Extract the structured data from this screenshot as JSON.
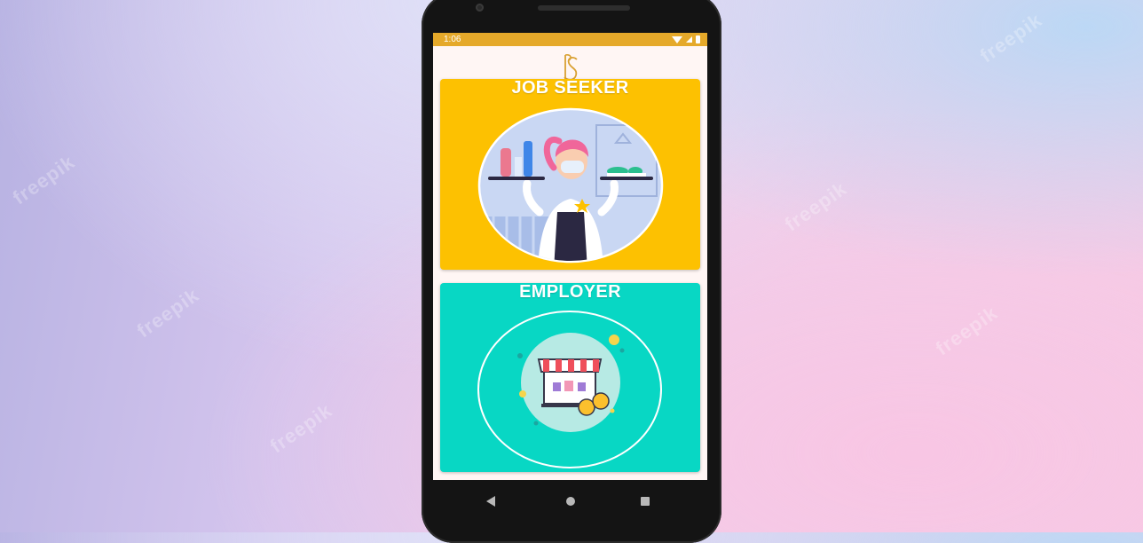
{
  "status_bar": {
    "time": "1:06",
    "icons": [
      "wifi-icon",
      "signal-icon",
      "battery-icon"
    ]
  },
  "logo": {
    "text": "S"
  },
  "cards": {
    "job_seeker": {
      "title": "JOB SEEKER",
      "color": "#fdc101",
      "illustration": "waitress-illustration"
    },
    "employer": {
      "title": "EMPLOYER",
      "color": "#08d7c4",
      "illustration": "shop-illustration"
    }
  },
  "nav_bar": {
    "icons": [
      "back-icon",
      "home-icon",
      "recents-icon"
    ]
  },
  "watermark": {
    "text": "freepik"
  },
  "colors": {
    "status_bar": "#e5a92a",
    "screen_bg": "#fff6f4"
  }
}
